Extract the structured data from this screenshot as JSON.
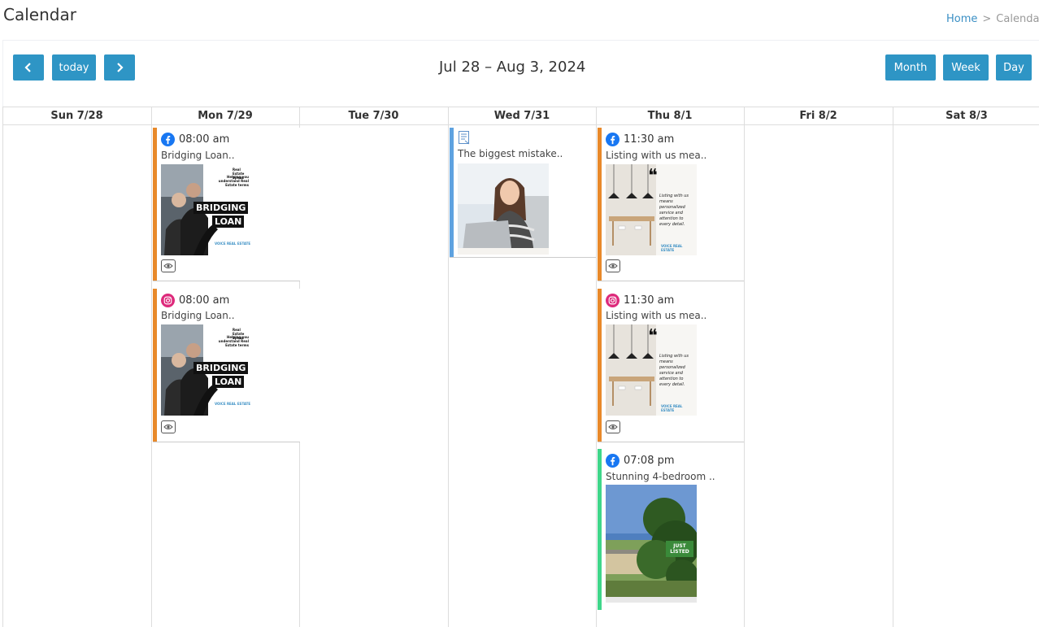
{
  "page": {
    "title": "Calendar"
  },
  "breadcrumb": {
    "home": "Home",
    "separator": ">",
    "current": "Calenda"
  },
  "toolbar": {
    "prev_icon": "chevron-left-icon",
    "today_label": "today",
    "next_icon": "chevron-right-icon",
    "range_title": "Jul 28 – Aug 3, 2024",
    "month_label": "Month",
    "week_label": "Week",
    "day_label": "Day"
  },
  "days": [
    {
      "label": "Sun 7/28"
    },
    {
      "label": "Mon 7/29"
    },
    {
      "label": "Tue 7/30"
    },
    {
      "label": "Wed 7/31"
    },
    {
      "label": "Thu 8/1"
    },
    {
      "label": "Fri 8/2"
    },
    {
      "label": "Sat 8/3"
    }
  ],
  "events": {
    "mon_fb": {
      "platform": "facebook",
      "time": "08:00 am",
      "text": "Bridging Loan..",
      "image": {
        "small": "Real Estate Speak",
        "sub": "Helping you understand Real Estate terms",
        "line1": "BRIDGING",
        "line2": "LOAN",
        "brand": "VOICE REAL ESTATE"
      }
    },
    "mon_ig": {
      "platform": "instagram",
      "time": "08:00 am",
      "text": "Bridging Loan..",
      "image": {
        "small": "Real Estate Speak",
        "sub": "Helping you understand Real Estate terms",
        "line1": "BRIDGING",
        "line2": "LOAN",
        "brand": "VOICE REAL ESTATE"
      }
    },
    "wed_blog": {
      "platform": "blog",
      "text": "The biggest mistake.."
    },
    "thu_fb": {
      "platform": "facebook",
      "time": "11:30 am",
      "text": "Listing with us mea..",
      "image": {
        "quote": "❝",
        "body": "Listing with us means personalized service and attention to every detail.",
        "brand": "VOICE REAL ESTATE"
      }
    },
    "thu_ig": {
      "platform": "instagram",
      "time": "11:30 am",
      "text": "Listing with us mea..",
      "image": {
        "quote": "❝",
        "body": "Listing with us means personalized service and attention to every detail.",
        "brand": "VOICE REAL ESTATE"
      }
    },
    "thu_fb2": {
      "platform": "facebook",
      "time": "07:08 pm",
      "text": "Stunning 4-bedroom ..",
      "image": {
        "badge": "JUST LISTED"
      }
    }
  },
  "colors": {
    "primary_button": "#2e95c5",
    "event_orange": "#e8892a",
    "event_blue": "#5ea2e0",
    "event_green": "#3fd68a",
    "facebook": "#1877f2",
    "instagram": "#dd2a7b"
  }
}
